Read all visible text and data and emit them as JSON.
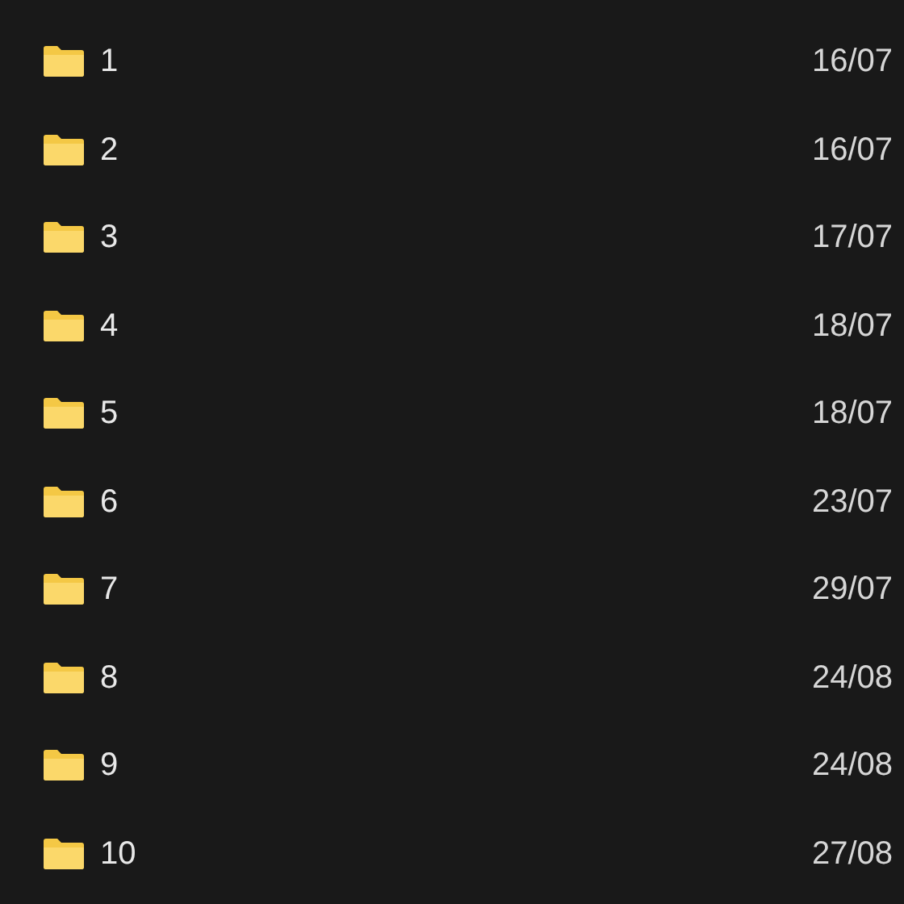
{
  "files": [
    {
      "name": "1",
      "date": "16/07"
    },
    {
      "name": "2",
      "date": "16/07"
    },
    {
      "name": "3",
      "date": "17/07"
    },
    {
      "name": "4",
      "date": "18/07"
    },
    {
      "name": "5",
      "date": "18/07"
    },
    {
      "name": "6",
      "date": "23/07"
    },
    {
      "name": "7",
      "date": "29/07"
    },
    {
      "name": "8",
      "date": "24/08"
    },
    {
      "name": "9",
      "date": "24/08"
    },
    {
      "name": "10",
      "date": "27/08"
    }
  ]
}
